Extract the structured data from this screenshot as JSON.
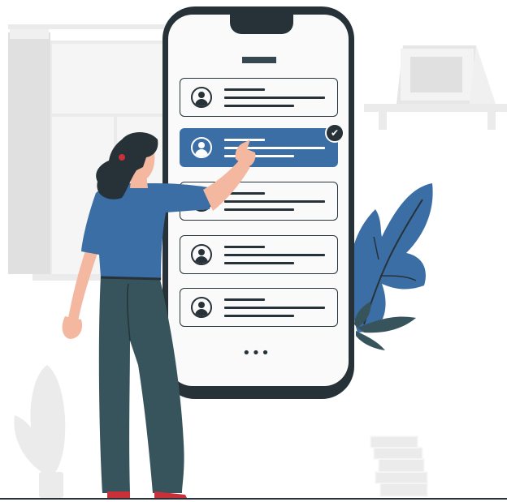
{
  "illustration": {
    "subject": "contact-selection",
    "colors": {
      "accent": "#3a6ea5",
      "dark": "#263238",
      "pants": "#37545c",
      "background_gray": "#ebebeb",
      "shoes": "#c8303a"
    }
  },
  "phone": {
    "title_icon": "title-bar",
    "contacts": [
      {
        "icon": "user-icon",
        "selected": false
      },
      {
        "icon": "user-icon",
        "selected": true
      },
      {
        "icon": "user-icon",
        "selected": false
      },
      {
        "icon": "user-icon",
        "selected": false
      },
      {
        "icon": "user-icon",
        "selected": false
      }
    ],
    "selected_badge_icon": "check-icon",
    "selected_badge_glyph": "✔",
    "more_icon": "more-dots-icon",
    "more_glyph": "•••"
  }
}
